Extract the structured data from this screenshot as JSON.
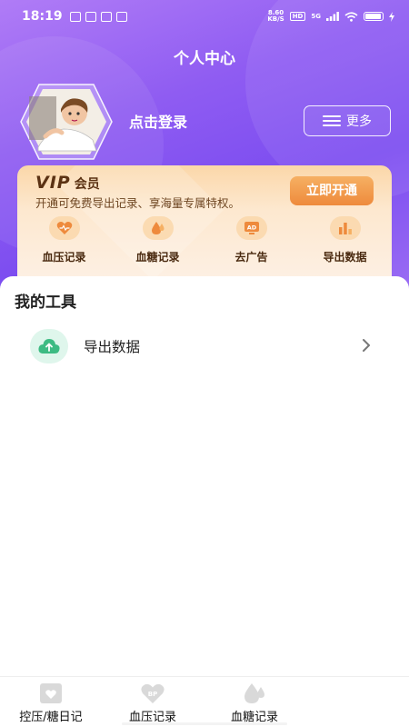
{
  "status_bar": {
    "time": "18:19",
    "net_speed_value": "8.60",
    "net_speed_unit": "KB/S",
    "hd_badge": "HD",
    "signal_label": "5G"
  },
  "header": {
    "title": "个人中心"
  },
  "profile": {
    "login_text": "点击登录",
    "more_label": "更多"
  },
  "vip": {
    "brand": "VIP",
    "member_label": "会员",
    "description": "开通可免费导出记录、享海量专属特权。",
    "cta_label": "立即开通",
    "features": [
      {
        "label": "血压记录",
        "icon": "heart-icon"
      },
      {
        "label": "血糖记录",
        "icon": "drop-icon"
      },
      {
        "label": "去广告",
        "icon": "ad-icon"
      },
      {
        "label": "导出数据",
        "icon": "bar-chart-icon"
      }
    ]
  },
  "tools": {
    "section_title": "我的工具",
    "items": [
      {
        "label": "导出数据",
        "icon": "cloud-upload-icon"
      }
    ]
  },
  "bottom_nav": {
    "items": [
      {
        "label": "控压/糖日记",
        "icon": "diary-icon"
      },
      {
        "label": "血压记录",
        "icon": "bp-icon"
      },
      {
        "label": "血糖记录",
        "icon": "drop-icon"
      }
    ]
  },
  "colors": {
    "hero_gradient": [
      "#b07cf6",
      "#7b4cf0"
    ],
    "vip_cta": "#ee8a3c",
    "vip_text": "#5b3213",
    "tool_icon_bg": "#dff6ec",
    "tool_icon": "#3dbb83"
  }
}
